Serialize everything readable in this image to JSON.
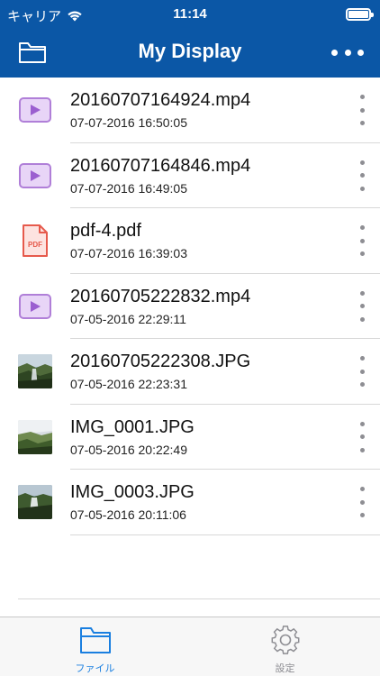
{
  "status_bar": {
    "carrier": "キャリア",
    "time": "11:14"
  },
  "nav": {
    "title": "My Display"
  },
  "files": [
    {
      "name": "20160707164924.mp4",
      "date": "07-07-2016 16:50:05",
      "type": "video",
      "icon": "video-file-icon"
    },
    {
      "name": "20160707164846.mp4",
      "date": "07-07-2016 16:49:05",
      "type": "video",
      "icon": "video-file-icon"
    },
    {
      "name": "pdf-4.pdf",
      "date": "07-07-2016 16:39:03",
      "type": "pdf",
      "icon": "pdf-file-icon",
      "icon_label": "PDF"
    },
    {
      "name": "20160705222832.mp4",
      "date": "07-05-2016 22:29:11",
      "type": "video",
      "icon": "video-file-icon"
    },
    {
      "name": "20160705222308.JPG",
      "date": "07-05-2016 22:23:31",
      "type": "image",
      "icon": "photo-thumbnail"
    },
    {
      "name": "IMG_0001.JPG",
      "date": "07-05-2016 20:22:49",
      "type": "image",
      "icon": "photo-thumbnail"
    },
    {
      "name": "IMG_0003.JPG",
      "date": "07-05-2016 20:11:06",
      "type": "image",
      "icon": "photo-thumbnail"
    }
  ],
  "tabs": [
    {
      "label": "ファイル",
      "icon": "folder-icon",
      "active": true
    },
    {
      "label": "設定",
      "icon": "gear-icon",
      "active": false
    }
  ],
  "colors": {
    "nav_bg": "#0b57a6",
    "accent": "#1a7fe0",
    "video_icon": "#b07fd8",
    "pdf_icon": "#e65a4c"
  }
}
